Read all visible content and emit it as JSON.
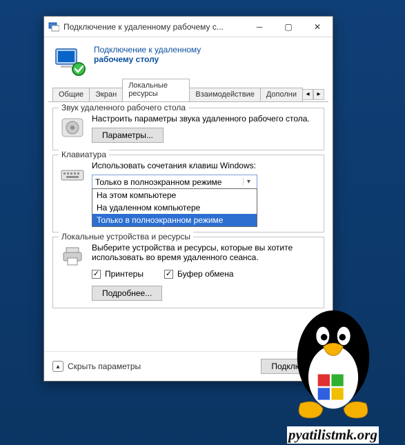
{
  "titlebar": {
    "title": "Подключение к удаленному рабочему с..."
  },
  "header": {
    "line1": "Подключение к удаленному",
    "line2": "рабочему столу"
  },
  "tabs": {
    "items": [
      {
        "label": "Общие"
      },
      {
        "label": "Экран"
      },
      {
        "label": "Локальные ресурсы"
      },
      {
        "label": "Взаимодействие"
      },
      {
        "label": "Дополни"
      }
    ],
    "active_index": 2
  },
  "audio": {
    "legend": "Звук удаленного рабочего стола",
    "text": "Настроить параметры звука удаленного рабочего стола.",
    "button": "Параметры..."
  },
  "keyboard": {
    "legend": "Клавиатура",
    "text": "Использовать сочетания клавиш Windows:",
    "selected": "Только в полноэкранном режиме",
    "options": [
      "На этом компьютере",
      "На удаленном компьютере",
      "Только в полноэкранном режиме"
    ]
  },
  "local": {
    "legend": "Локальные устройства и ресурсы",
    "text": "Выберите устройства и ресурсы, которые вы хотите использовать во время удаленного сеанса.",
    "printers": "Принтеры",
    "clipboard": "Буфер обмена",
    "more": "Подробнее..."
  },
  "footer": {
    "hide": "Скрыть параметры",
    "connect": "Подключит"
  },
  "watermark": {
    "url": "pyatilistmk.org"
  }
}
